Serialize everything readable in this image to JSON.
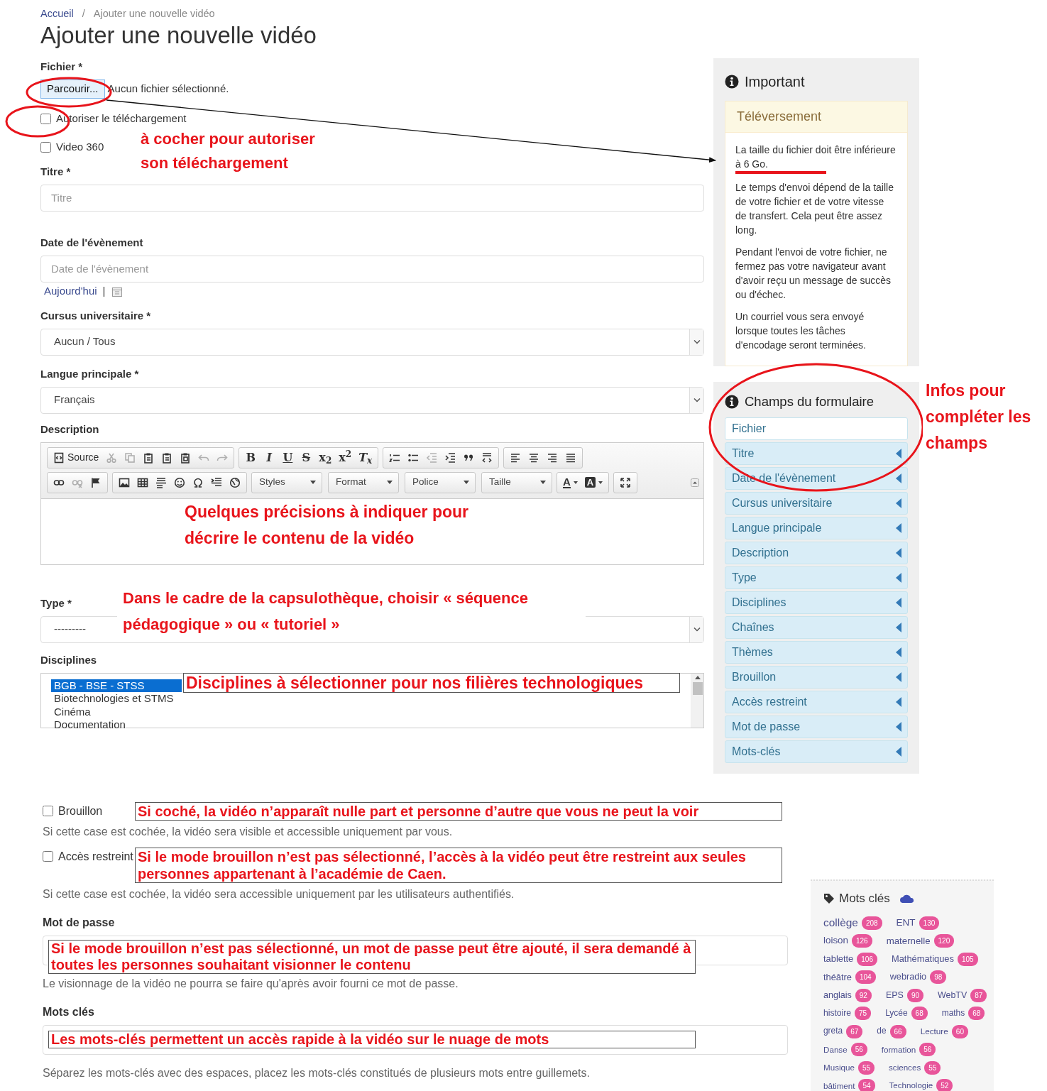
{
  "breadcrumb": [
    {
      "label": "Accueil",
      "link": true
    },
    {
      "label": "/",
      "link": false
    },
    {
      "label": "Ajouter une nouvelle vidéo",
      "link": false
    }
  ],
  "title": "Ajouter une nouvelle vidéo",
  "form": {
    "file": {
      "label": "Fichier *",
      "button": "Parcourir...",
      "status": "Aucun fichier sélectionné."
    },
    "top_checkboxes": [
      {
        "label": "Autoriser le téléchargement",
        "checked": false
      },
      {
        "label": "Video 360",
        "checked": false
      }
    ],
    "download_note": "à cocher pour autoriser son téléchargement",
    "title_field": {
      "label": "Titre *",
      "placeholder": "Titre"
    },
    "date_field": {
      "label": "Date de l'évènement",
      "placeholder": "Date de l'évènement",
      "today_link": "Aujourd'hui",
      "separator": "|"
    },
    "cursus": {
      "label": "Cursus universitaire *",
      "value": "Aucun / Tous"
    },
    "language": {
      "label": "Langue principale *",
      "value": "Français"
    },
    "description": {
      "label": "Description",
      "note": "Quelques précisions à indiquer pour décrire le contenu de la vidéo",
      "toolbar": [
        [
          [
            {
              "label": "Source",
              "disabled": false
            },
            {
              "disabled": true
            },
            {
              "disabled": true
            },
            {
              "disabled": false
            },
            {
              "disabled": false
            },
            {
              "disabled": false
            },
            {
              "disabled": true
            },
            {
              "disabled": true
            }
          ],
          [
            {
              "label": "B",
              "disabled": false
            },
            {
              "label": "I",
              "disabled": false
            },
            {
              "label": "U",
              "disabled": false
            },
            {
              "label": "S",
              "disabled": false
            },
            {
              "label": "x$_{2}$",
              "disabled": false
            },
            {
              "label": "x$^{2}$",
              "disabled": false
            },
            {
              "label": "T$_{x}$",
              "disabled": false
            }
          ],
          [
            {
              "disabled": false
            },
            {
              "disabled": false
            },
            {
              "disabled": true
            },
            {
              "disabled": false
            },
            {
              "disabled": false
            },
            {
              "disabled": false
            }
          ],
          [
            {
              "disabled": false
            },
            {
              "disabled": false
            },
            {
              "disabled": false
            },
            {
              "disabled": false
            }
          ]
        ],
        [
          [
            {
              "disabled": false
            },
            {
              "disabled": true
            },
            {
              "disabled": false
            }
          ],
          [
            {
              "disabled": false
            },
            {
              "disabled": false
            },
            {
              "disabled": false
            },
            {
              "disabled": false
            },
            {
              "disabled": false
            },
            {
              "disabled": false
            },
            {
              "disabled": false
            }
          ],
          [
            {
              "combo": "Styles"
            },
            {
              "combo": "Format"
            },
            {
              "combo": "Police"
            },
            {
              "combo": "Taille"
            }
          ],
          [
            {
              "label": "A",
              "disabled": false
            },
            {
              "label": "A",
              "disabled": false
            }
          ],
          [
            {
              "disabled": false
            }
          ]
        ]
      ]
    },
    "type": {
      "label": "Type *",
      "value": "---------",
      "note": "Dans le cadre de la capsulothèque, choisir « séquence pédagogique » ou « tutoriel »"
    },
    "disciplines": {
      "label": "Disciplines",
      "note": "Disciplines à sélectionner pour nos filières technologiques",
      "options": [
        {
          "label": "BGB - BSE - STSS",
          "selected": true
        },
        {
          "label": "Biotechnologies et STMS",
          "selected": false
        },
        {
          "label": "Cinéma",
          "selected": false
        },
        {
          "label": "Documentation",
          "selected": false
        }
      ]
    },
    "draft": {
      "label": "Brouillon",
      "checked": false,
      "note": "Si coché, la vidéo n’apparaît nulle part et personne d’autre que vous ne peut la voir",
      "help": "Si cette case est cochée, la vidéo sera visible et accessible uniquement par vous."
    },
    "restricted": {
      "label": "Accès restreint",
      "checked": false,
      "note": "Si le mode brouillon n’est pas sélectionné, l’accès à la vidéo peut être restreint aux seules personnes appartenant à l’académie de Caen.",
      "help": "Si cette case est cochée, la vidéo sera accessible uniquement par les utilisateurs authentifiés."
    },
    "password": {
      "label": "Mot de passe",
      "note": "Si le mode brouillon n’est pas sélectionné, un mot de passe peut être ajouté, il sera demandé à toutes les personnes souhaitant visionner le contenu",
      "help": "Le visionnage de la vidéo ne pourra se faire qu'après avoir fourni ce mot de passe."
    },
    "keywords": {
      "label": "Mots clés",
      "note": "Les mots-clés permettent un accès rapide à la vidéo sur le nuage de mots",
      "help": "Séparez les mots-clés avec des espaces, placez les mots-clés constitués de plusieurs mots entre guillemets."
    }
  },
  "important": {
    "title": "Important",
    "card_title": "Téléversement",
    "paragraphs": [
      "La taille du fichier doit être inférieure à 6 Go.",
      "Le temps d'envoi dépend de la taille de votre fichier et de votre vitesse de transfert. Cela peut être assez long.",
      "Pendant l'envoi de votre fichier, ne fermez pas votre navigateur avant d'avoir reçu un message de succès ou d'échec.",
      "Un courriel vous sera envoyé lorsque toutes les tâches d'encodage seront terminées."
    ]
  },
  "fields_panel": {
    "title": "Champs du formulaire",
    "note": "Infos pour compléter les champs",
    "items": [
      {
        "label": "Fichier",
        "selected": true
      },
      {
        "label": "Titre",
        "selected": false
      },
      {
        "label": "Date de l'évènement",
        "selected": false
      },
      {
        "label": "Cursus universitaire",
        "selected": false
      },
      {
        "label": "Langue principale",
        "selected": false
      },
      {
        "label": "Description",
        "selected": false
      },
      {
        "label": "Type",
        "selected": false
      },
      {
        "label": "Disciplines",
        "selected": false
      },
      {
        "label": "Chaînes",
        "selected": false
      },
      {
        "label": "Thèmes",
        "selected": false
      },
      {
        "label": "Brouillon",
        "selected": false
      },
      {
        "label": "Accès restreint",
        "selected": false
      },
      {
        "label": "Mot de passe",
        "selected": false
      },
      {
        "label": "Mots-clés",
        "selected": false
      }
    ]
  },
  "keyword_cloud": {
    "title": "Mots clés",
    "tags": [
      {
        "label": "collège",
        "count": "208"
      },
      {
        "label": "ENT",
        "count": "130"
      },
      {
        "label": "loison",
        "count": "126"
      },
      {
        "label": "maternelle",
        "count": "120"
      },
      {
        "label": "tablette",
        "count": "106"
      },
      {
        "label": "Mathématiques",
        "count": "105"
      },
      {
        "label": "théâtre",
        "count": "104"
      },
      {
        "label": "webradio",
        "count": "98"
      },
      {
        "label": "anglais",
        "count": "92"
      },
      {
        "label": "EPS",
        "count": "90"
      },
      {
        "label": "WebTV",
        "count": "87"
      },
      {
        "label": "histoire",
        "count": "75"
      },
      {
        "label": "Lycée",
        "count": "68"
      },
      {
        "label": "maths",
        "count": "68"
      },
      {
        "label": "greta",
        "count": "67"
      },
      {
        "label": "de",
        "count": "66"
      },
      {
        "label": "Lecture",
        "count": "60"
      },
      {
        "label": "Danse",
        "count": "56"
      },
      {
        "label": "formation",
        "count": "56"
      },
      {
        "label": "Musique",
        "count": "55"
      },
      {
        "label": "sciences",
        "count": "55"
      },
      {
        "label": "bâtiment",
        "count": "54"
      },
      {
        "label": "Technologie",
        "count": "52"
      }
    ]
  }
}
